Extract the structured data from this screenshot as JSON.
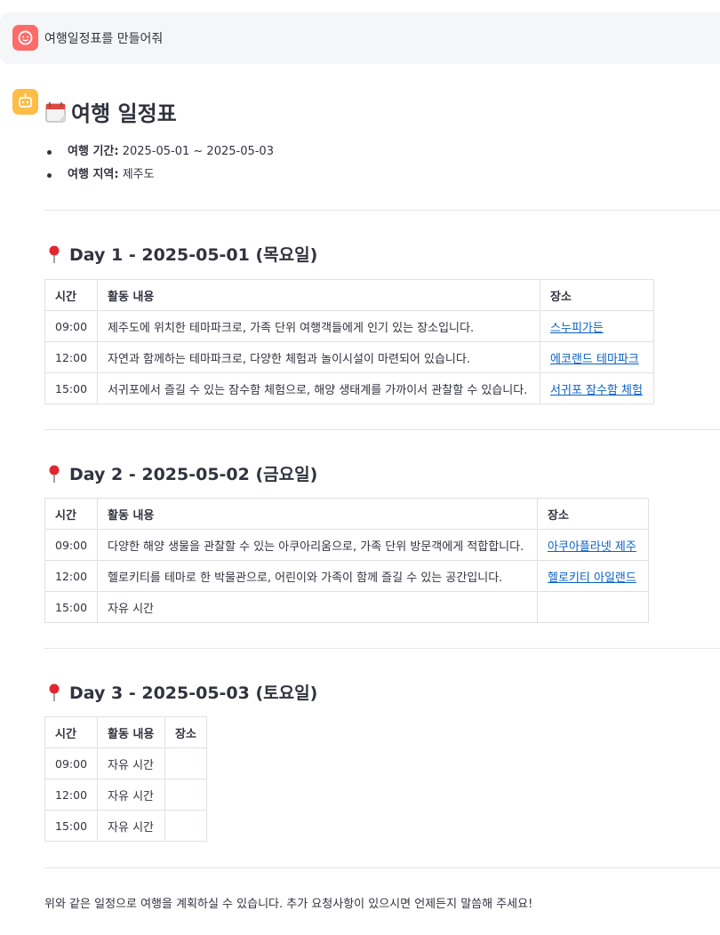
{
  "user_message": {
    "text": "여행일정표를 만들어줘"
  },
  "title": "여행 일정표",
  "meta": {
    "period_label": "여행 기간:",
    "period_value": "2025-05-01 ~ 2025-05-03",
    "region_label": "여행 지역:",
    "region_value": "제주도"
  },
  "days": [
    {
      "title": "Day 1 - 2025-05-01 (목요일)",
      "headers": [
        "시간",
        "활동 내용",
        "장소"
      ],
      "rows": [
        {
          "time": "09:00",
          "activity": "제주도에 위치한 테마파크로, 가족 단위 여행객들에게 인기 있는 장소입니다.",
          "place": "스누피가든"
        },
        {
          "time": "12:00",
          "activity": "자연과 함께하는 테마파크로, 다양한 체험과 놀이시설이 마련되어 있습니다.",
          "place": "에코랜드 테마파크"
        },
        {
          "time": "15:00",
          "activity": "서귀포에서 즐길 수 있는 잠수함 체험으로, 해양 생태계를 가까이서 관찰할 수 있습니다.",
          "place": "서귀포 잠수함 체험"
        }
      ]
    },
    {
      "title": "Day 2 - 2025-05-02 (금요일)",
      "headers": [
        "시간",
        "활동 내용",
        "장소"
      ],
      "rows": [
        {
          "time": "09:00",
          "activity": "다양한 해양 생물을 관찰할 수 있는 아쿠아리움으로, 가족 단위 방문객에게 적합합니다.",
          "place": "아쿠아플라넷 제주"
        },
        {
          "time": "12:00",
          "activity": "헬로키티를 테마로 한 박물관으로, 어린이와 가족이 함께 즐길 수 있는 공간입니다.",
          "place": "헬로키티 아일랜드"
        },
        {
          "time": "15:00",
          "activity": "자유 시간",
          "place": ""
        }
      ]
    },
    {
      "title": "Day 3 - 2025-05-03 (토요일)",
      "headers": [
        "시간",
        "활동 내용",
        "장소"
      ],
      "rows": [
        {
          "time": "09:00",
          "activity": "자유 시간",
          "place": ""
        },
        {
          "time": "12:00",
          "activity": "자유 시간",
          "place": ""
        },
        {
          "time": "15:00",
          "activity": "자유 시간",
          "place": ""
        }
      ]
    }
  ],
  "closing": "위와 같은 일정으로 여행을 계획하실 수 있습니다. 추가 요청사항이 있으시면 언제든지 말씀해 주세요!",
  "colors": {
    "link": "#0b62c4",
    "user_avatar": "#fd6b6b",
    "bot_avatar": "#ffbd45",
    "pin": "#e0272f"
  },
  "icons": {
    "user": "face-icon",
    "bot": "robot-icon",
    "title": "calendar-icon",
    "day": "pin-icon"
  }
}
